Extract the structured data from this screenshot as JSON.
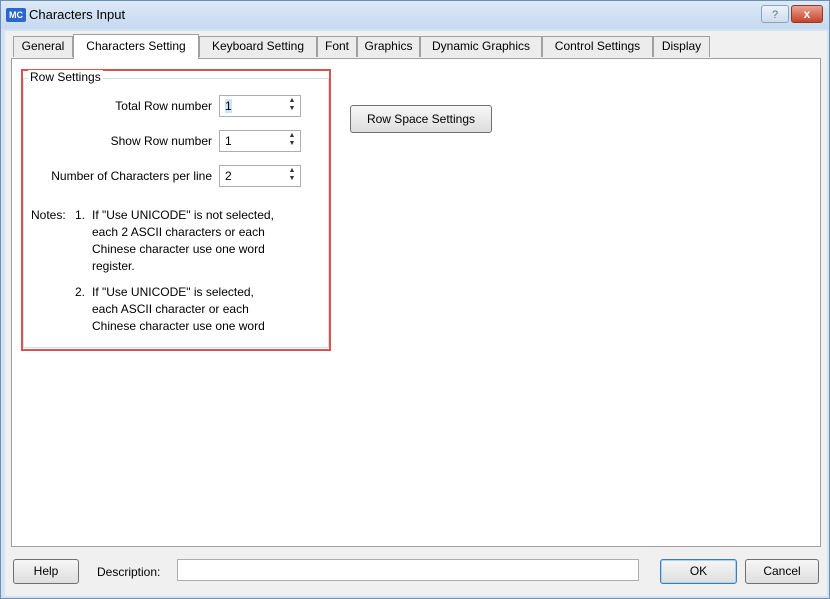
{
  "window": {
    "app_icon": "MC",
    "title": "Characters Input",
    "help_btn": "?",
    "close_btn": "x"
  },
  "tabs": [
    {
      "label": "General"
    },
    {
      "label": "Characters Setting"
    },
    {
      "label": "Keyboard Setting"
    },
    {
      "label": "Font"
    },
    {
      "label": "Graphics"
    },
    {
      "label": "Dynamic Graphics"
    },
    {
      "label": "Control Settings"
    },
    {
      "label": "Display"
    }
  ],
  "active_tab": "Characters Setting",
  "row_settings": {
    "title": "Row Settings",
    "total_row_label": "Total Row number",
    "total_row_value": "1",
    "show_row_label": "Show Row number",
    "show_row_value": "1",
    "chars_per_line_label": "Number of Characters per line",
    "chars_per_line_value": "2"
  },
  "notes": {
    "prefix": "Notes:",
    "n1": "1.",
    "n1_lines": [
      "If \"Use UNICODE\" is not selected,",
      "each 2 ASCII characters or each",
      "Chinese character use one  word",
      "register."
    ],
    "n2": "2.",
    "n2_lines": [
      "If \"Use UNICODE\" is selected,",
      "each ASCII character or each",
      "Chinese character use one  word"
    ]
  },
  "row_space_button": "Row Space Settings",
  "bottom": {
    "help": "Help",
    "description_label": "Description:",
    "description_value": "",
    "ok": "OK",
    "cancel": "Cancel"
  }
}
